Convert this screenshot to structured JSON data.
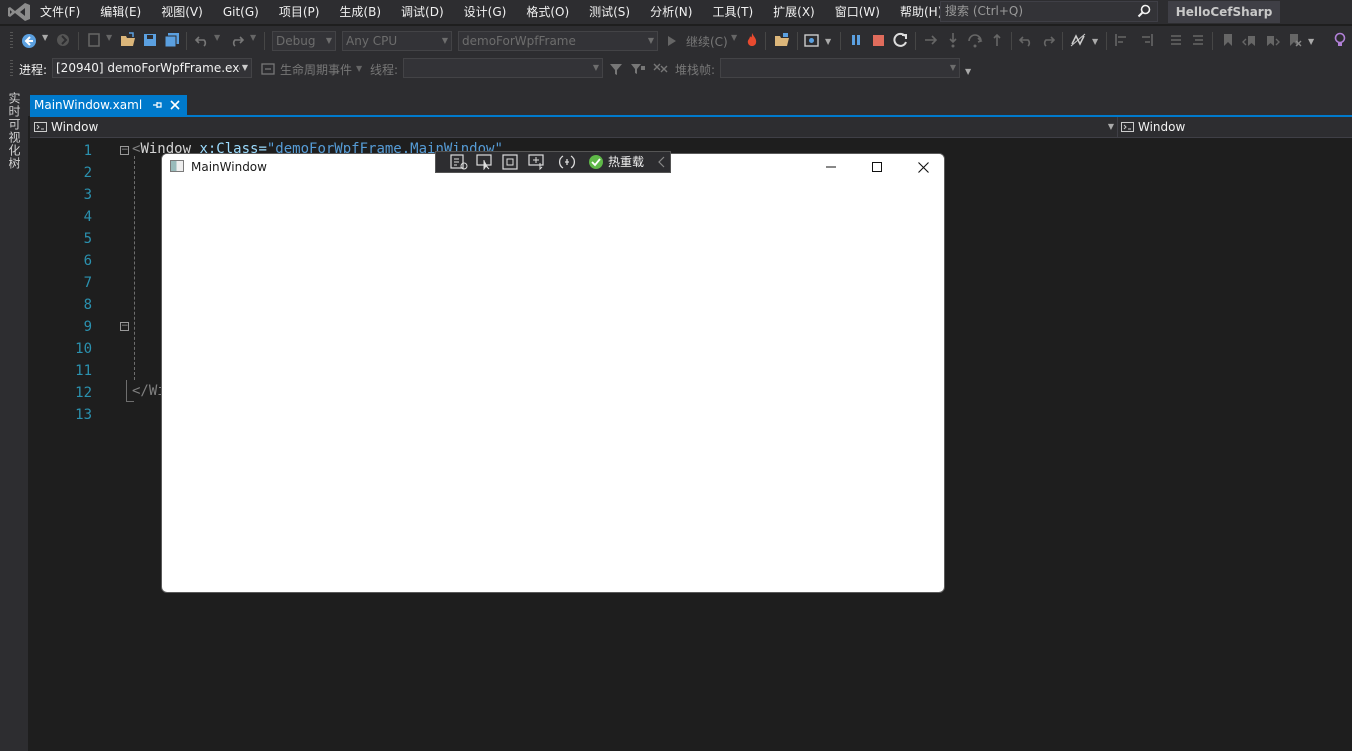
{
  "menu": {
    "items": [
      "文件(F)",
      "编辑(E)",
      "视图(V)",
      "Git(G)",
      "项目(P)",
      "生成(B)",
      "调试(D)",
      "设计(G)",
      "格式(O)",
      "测试(S)",
      "分析(N)",
      "工具(T)",
      "扩展(X)",
      "窗口(W)",
      "帮助(H)"
    ],
    "search_placeholder": "搜索 (Ctrl+Q)",
    "solution_name": "HelloCefSharp"
  },
  "toolbar": {
    "config": "Debug",
    "platform": "Any CPU",
    "startup_project": "demoForWpfFrame",
    "continue_label": "继续(C)"
  },
  "debug_bar": {
    "process_label": "进程:",
    "process_value": "[20940] demoForWpfFrame.exe",
    "lifecycle_label": "生命周期事件",
    "thread_label": "线程:",
    "stackframe_label": "堆栈帧:"
  },
  "side_panel": {
    "label": "实时可视化树"
  },
  "document": {
    "tab_title": "MainWindow.xaml",
    "nav_left": "Window",
    "nav_right": "Window",
    "line_numbers": [
      "1",
      "2",
      "3",
      "4",
      "5",
      "6",
      "7",
      "8",
      "9",
      "10",
      "11",
      "12",
      "13"
    ],
    "code_line1_prefix": "<",
    "code_line1_tag": "Window",
    "code_line1_attr": " x:Class=",
    "code_line1_value": "\"demoForWpfFrame.MainWindow\"",
    "code_line12": "</Wi"
  },
  "running_window": {
    "title": "MainWindow",
    "hot_reload_label": "热重载"
  },
  "colors": {
    "accent": "#007acc",
    "background": "#1e1e1e",
    "chrome": "#2d2d30"
  }
}
